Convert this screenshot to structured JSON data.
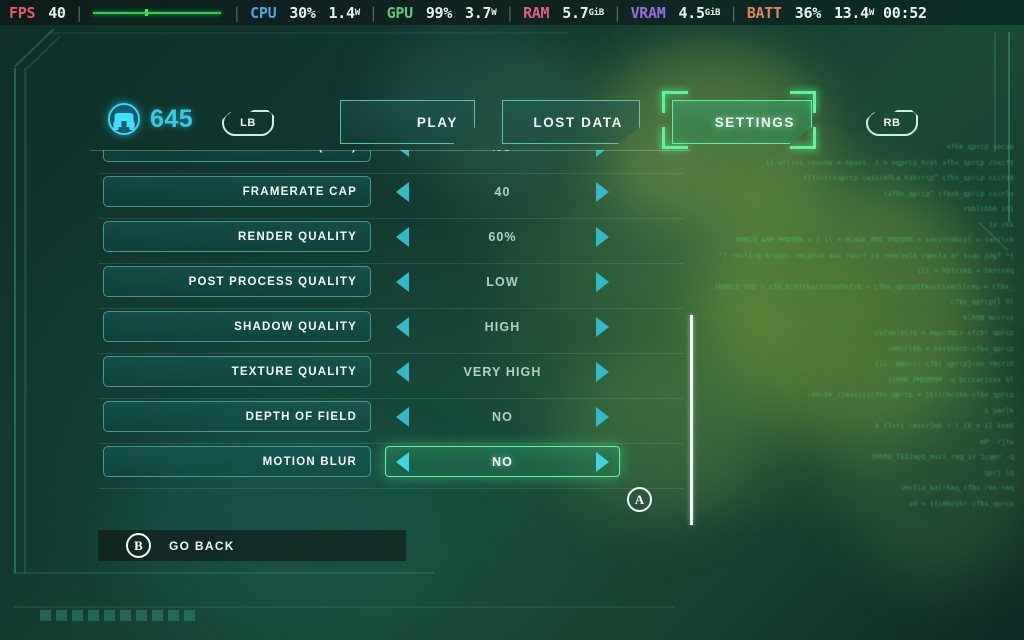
{
  "osd": {
    "items": [
      {
        "label": "FPS",
        "color": "#e8566b",
        "value": "40",
        "unit": "",
        "graph": true
      },
      {
        "label": "CPU",
        "color": "#4aa8e0",
        "value": "30%",
        "value2": "1.4",
        "unit": "W"
      },
      {
        "label": "GPU",
        "color": "#5bc77a",
        "value": "99%",
        "value2": "3.7",
        "unit": "W"
      },
      {
        "label": "RAM",
        "color": "#e05b8a",
        "value": "5.7",
        "unit": "GiB"
      },
      {
        "label": "VRAM",
        "color": "#9b6be0",
        "value": "4.5",
        "unit": "GiB"
      },
      {
        "label": "BATT",
        "color": "#e0855b",
        "value": "36%",
        "value2": "13.4",
        "unit": "W"
      }
    ],
    "clock": "00:52"
  },
  "header": {
    "currency_amount": "645",
    "currency_icon": "helmet-coin-icon",
    "bumper_left": "LB",
    "bumper_right": "RB",
    "tabs": [
      {
        "label": "PLAY",
        "selected": false
      },
      {
        "label": "LOST DATA",
        "selected": false
      },
      {
        "label": "SETTINGS",
        "selected": true
      }
    ]
  },
  "settings": {
    "rows": [
      {
        "name": "HIGH DYNAMIC RANGE (HDR)",
        "value": "NO",
        "selected": false
      },
      {
        "name": "FRAMERATE CAP",
        "value": "40",
        "selected": false
      },
      {
        "name": "RENDER QUALITY",
        "value": "60%",
        "selected": false
      },
      {
        "name": "POST PROCESS QUALITY",
        "value": "LOW",
        "selected": false
      },
      {
        "name": "SHADOW QUALITY",
        "value": "HIGH",
        "selected": false
      },
      {
        "name": "TEXTURE QUALITY",
        "value": "VERY HIGH",
        "selected": false
      },
      {
        "name": "DEPTH OF FIELD",
        "value": "NO",
        "selected": false
      },
      {
        "name": "MOTION BLUR",
        "value": "NO",
        "selected": true
      }
    ],
    "confirm_hint": "A",
    "back_hint": "B",
    "back_label": "GO BACK"
  },
  "colors": {
    "accent_green": "#5cf59b",
    "accent_cyan": "#35b9c9",
    "panel_teal": "#166060",
    "text_light": "#f2fbf8"
  },
  "decor": {
    "code_lines": [
      "xfbk_qprcp socse",
      "{{ vrjios_coovne = npaes. } = nqprcp_hcol xfbx_qprcp /oxcft",
      "{{{cccrsqprcp cwiicmfLa kabrrcp^ cfbx_qprcp cccrsk",
      "(xfbx_qprcp^ cfbxk_qprcp cscrlx",
      "rmblcbbh ini",
      "ix rkk",
      "",
      "QNRCQ_ARM_PMDQRR = { il = RCASK_RMI_PMDQRR = sacvrcmbcp{ = sacrlck",
      "^f rmclirq krucks rmcphcm anc raxcf ia romcaslk rqmcla ar scac pdgf *{",
      "{il = kblcskb = bkrcnkq",
      "{QNRCQ_VIQ = cfo_bipjrbxcrrcmxbkfrb = cfbx_qprcp{fkocnixmcllcms = cfbx_qprcp",
      "cfbx_qprcp{l bl",
      "klRRB mccrcs",
      "cstaklbciq = mqpcdqcr-cfcbl qprcp",
      "cmbcrlkb = kkrskbcb-cfbx_qprcp",
      "{il .mpacrc-cfbi_qprcp}cms_rmcrib",
      "",
      "{{KMK_PMDQRRM -q bcccaricns bl",
      "cmbcbk_rimscri{cfbx_qprcp = jbllcbcskb-cfbx_qprcp",
      "i smrlk",
      "",
      "k {l+ri cmscrlmk = l {k = il ksmk",
      "mP -rjtw",
      "{RKRQ_TSIimpq_mscl_rmq_ir icqmr -q",
      "qprj lq",
      "imcfla_kairkmq_cfbx_rms-cmq",
      "ad = {{cmbcsbr-cfbx_qprcp"
    ]
  }
}
